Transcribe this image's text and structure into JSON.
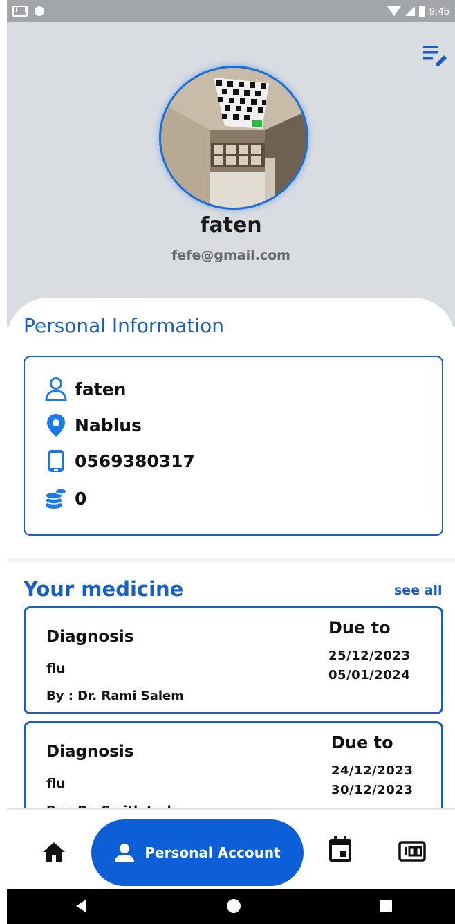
{
  "status_bar": {
    "time": "9:45"
  },
  "profile": {
    "name": "faten",
    "email": "fefe@gmail.com"
  },
  "personal_info": {
    "title": "Personal Information",
    "name": "faten",
    "city": "Nablus",
    "phone": "0569380317",
    "points": "0"
  },
  "medicine": {
    "title": "Your medicine",
    "see_all": "see all",
    "cards": [
      {
        "diagnosis_label": "Diagnosis",
        "diagnosis": "flu",
        "by": "By :  Dr. Rami Salem",
        "due_label": "Due to",
        "start": "25/12/2023",
        "end": "05/01/2024"
      },
      {
        "diagnosis_label": "Diagnosis",
        "diagnosis": "flu",
        "by": "By :  Dr. Smith Jack",
        "due_label": "Due to",
        "start": "24/12/2023",
        "end": "30/12/2023"
      }
    ]
  },
  "bottom_nav": {
    "active_label": "Personal Account"
  },
  "colors": {
    "primary": "#1a5fc0",
    "active_nav": "#0d5fd8",
    "header_bg": "#d9dde2"
  }
}
